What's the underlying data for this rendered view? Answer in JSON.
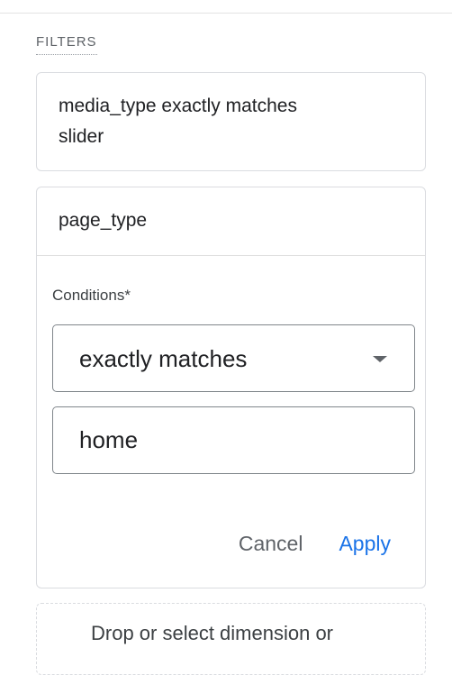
{
  "section": {
    "label": "FILTERS"
  },
  "filters": [
    {
      "summary": "media_type exactly matches slider"
    }
  ],
  "editor": {
    "dimension": "page_type",
    "conditions_label": "Conditions*",
    "match_type": "exactly matches",
    "value": "home",
    "cancel_label": "Cancel",
    "apply_label": "Apply"
  },
  "drop_zone": {
    "text": "Drop or select dimension or"
  },
  "colors": {
    "accent": "#1a73e8",
    "border": "#dadce0",
    "text": "#202124",
    "muted": "#5f6368"
  }
}
